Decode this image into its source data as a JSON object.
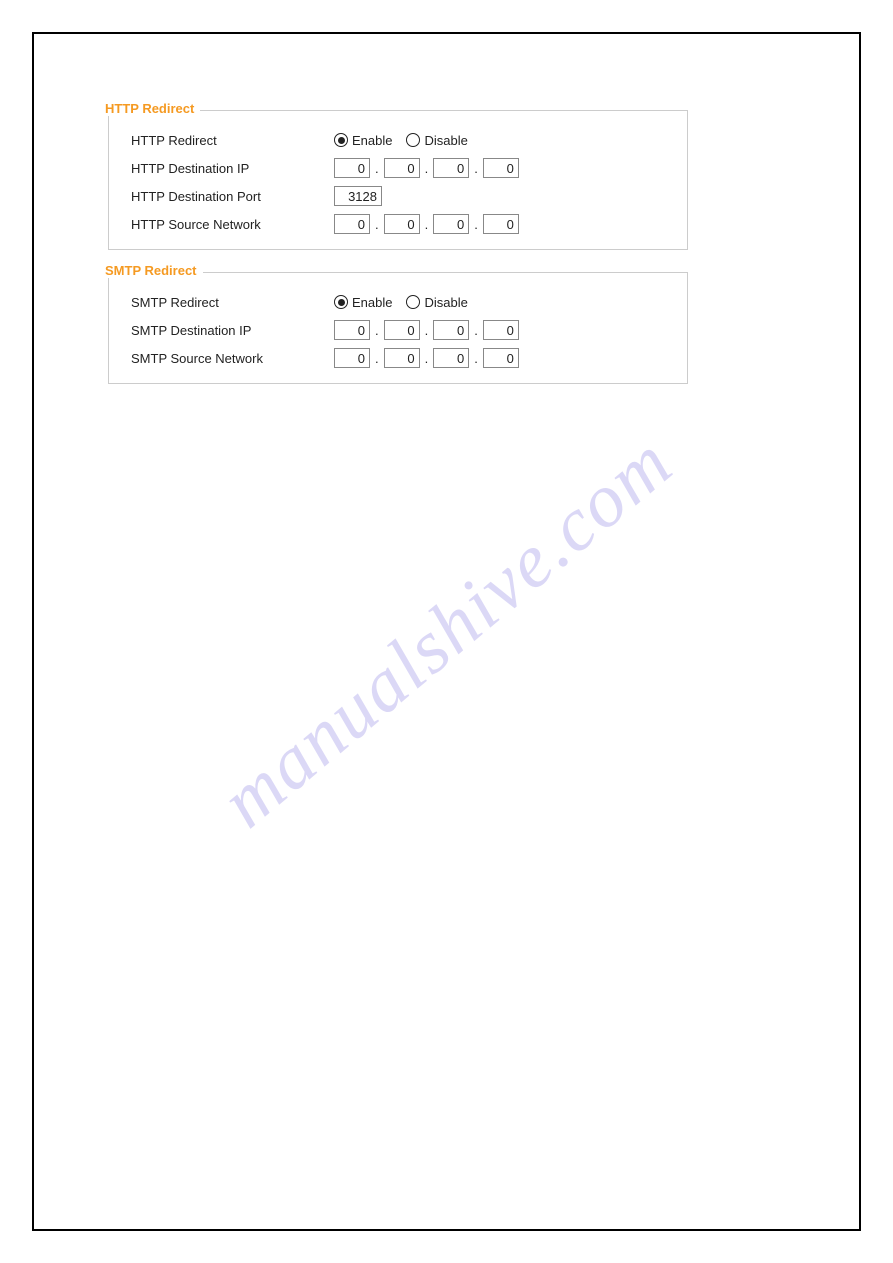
{
  "watermark": "manualshive.com",
  "http_redirect": {
    "title": "HTTP Redirect",
    "rows": {
      "redirect": {
        "label": "HTTP Redirect",
        "enable_label": "Enable",
        "disable_label": "Disable",
        "selected": "enable"
      },
      "dest_ip": {
        "label": "HTTP Destination IP",
        "octets": [
          "0",
          "0",
          "0",
          "0"
        ]
      },
      "dest_port": {
        "label": "HTTP Destination Port",
        "value": "3128"
      },
      "src_net": {
        "label": "HTTP Source Network",
        "octets": [
          "0",
          "0",
          "0",
          "0"
        ]
      }
    }
  },
  "smtp_redirect": {
    "title": "SMTP Redirect",
    "rows": {
      "redirect": {
        "label": "SMTP Redirect",
        "enable_label": "Enable",
        "disable_label": "Disable",
        "selected": "enable"
      },
      "dest_ip": {
        "label": "SMTP Destination IP",
        "octets": [
          "0",
          "0",
          "0",
          "0"
        ]
      },
      "src_net": {
        "label": "SMTP Source Network",
        "octets": [
          "0",
          "0",
          "0",
          "0"
        ]
      }
    }
  }
}
